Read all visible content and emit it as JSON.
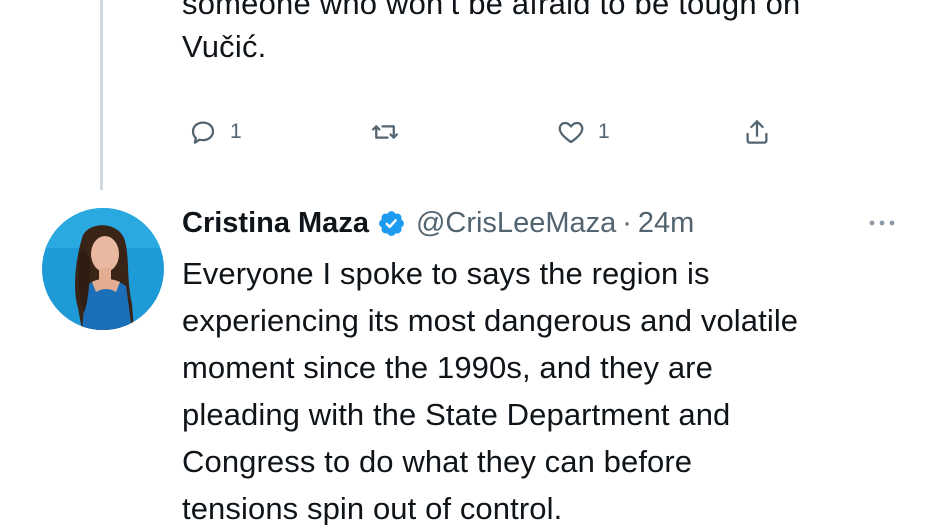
{
  "previous_tweet": {
    "text_lines": [
      "someone who won’t be afraid to be tough on",
      "Vučić."
    ],
    "actions": {
      "reply_icon": "reply-icon",
      "reply_count": "1",
      "retweet_icon": "retweet-icon",
      "like_icon": "heart-icon",
      "like_count": "1",
      "share_icon": "share-icon"
    }
  },
  "tweet": {
    "author": {
      "display_name": "Cristina Maza",
      "verified_icon": "verified-badge-icon",
      "handle": "@CrisLeeMaza",
      "separator": "·",
      "time": "24m"
    },
    "more_icon": "more-options-icon",
    "text_lines": [
      "Everyone I spoke to says the region is",
      "experiencing its most dangerous and volatile",
      "moment since the 1990s, and they are",
      "pleading with the State Department and",
      "Congress to do what they can before",
      "tensions spin out of control."
    ]
  },
  "colors": {
    "text": "#0f1419",
    "secondary": "#536471",
    "verified_blue": "#1d9bf0",
    "thread_line": "#cfd9de",
    "avatar_bg": "#1e9bd7"
  }
}
